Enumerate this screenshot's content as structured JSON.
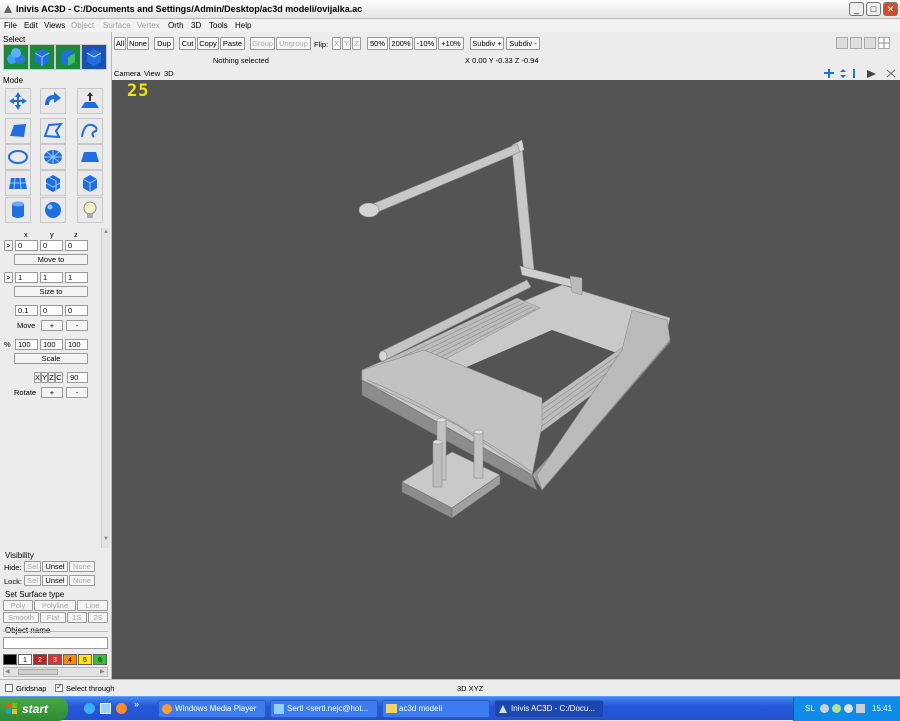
{
  "window": {
    "title": "Inivis AC3D - C:/Documents and Settings/Admin/Desktop/ac3d modeli/ovijalka.ac",
    "minimize": "_",
    "maximize": "□",
    "close": "✕"
  },
  "menu": {
    "items": [
      "File",
      "Edit",
      "Views",
      "Object",
      "Surface",
      "Vertex",
      "Orth",
      "3D",
      "Tools",
      "Help"
    ],
    "disabled": [
      "Object",
      "Surface",
      "Vertex"
    ]
  },
  "left": {
    "select_label": "Select",
    "mode_label": "Mode",
    "axis_x": "x",
    "axis_y": "y",
    "axis_z": "z",
    "pos_arrow": ">",
    "pos": [
      "0",
      "0",
      "0"
    ],
    "move_to": "Move to",
    "size_arrow": ">",
    "size": [
      "1",
      "1",
      "1"
    ],
    "size_to": "Size to",
    "move_vals": [
      "0.1",
      "0",
      "0"
    ],
    "move_label": "Move",
    "plus": "+",
    "minus": "-",
    "percent": "%",
    "scale_vals": [
      "100",
      "100",
      "100"
    ],
    "scale": "Scale",
    "rot_axes": [
      "X",
      "Y",
      "Z",
      "C"
    ],
    "rot_angle": "90",
    "rotate_label": "Rotate",
    "visibility_label": "Visibility",
    "hide_label": "Hide:",
    "lock_label": "Lock:",
    "sel": "Sel",
    "unsel": "Unsel",
    "none": "None",
    "surface_label": "Set Surface type",
    "poly": "Poly",
    "polyline": "Polyline",
    "line": "Line",
    "smooth": "Smooth",
    "flat": "Flat",
    "one_s": "1S",
    "two_s": "2S",
    "object_name_label": "Object name",
    "object_name": "",
    "palette": [
      {
        "label": "",
        "color": "#000000"
      },
      {
        "label": "1",
        "color": "#ffffff"
      },
      {
        "label": "2",
        "color": "#c02020"
      },
      {
        "label": "3",
        "color": "#e03030"
      },
      {
        "label": "4",
        "color": "#ff8a00"
      },
      {
        "label": "5",
        "color": "#ffe800"
      },
      {
        "label": "6",
        "color": "#30c030"
      }
    ]
  },
  "toolbar": {
    "all": "All",
    "none": "None",
    "dup": "Dup",
    "cut": "Cut",
    "copy": "Copy",
    "paste": "Paste",
    "group": "Group",
    "ungroup": "Ungroup",
    "flip": "Flip:",
    "flip_x": "X",
    "flip_y": "Y",
    "flip_z": "Z",
    "z50": "50%",
    "z200": "200%",
    "zm10": "-10%",
    "zp10": "+10%",
    "subdiv_plus": "Subdiv +",
    "subdiv_minus": "Subdiv -",
    "selection_status": "Nothing selected",
    "coords": "X 0.00 Y -0.33 Z -0.94"
  },
  "viewport": {
    "menu_camera": "Camera",
    "menu_view": "View",
    "menu_3d": "3D",
    "frame_counter": "25",
    "view_name": "3D XYZ"
  },
  "status": {
    "gridsnap": "Gridsnap",
    "select_through": "Select through"
  },
  "taskbar": {
    "start": "start",
    "tasks": [
      {
        "label": "Windows Media Player"
      },
      {
        "label": "Sertl <sertl.nejc@hot..."
      },
      {
        "label": "ac3d modeli"
      },
      {
        "label": "Inivis AC3D - C:/Docu..."
      }
    ],
    "lang": "SL",
    "time": "15:41"
  },
  "colors": {
    "viewport_bg": "#545454",
    "model_gray": "#c9c9c9",
    "counter_yellow": "#f2e600",
    "taskbar_blue": "#2458d8"
  }
}
